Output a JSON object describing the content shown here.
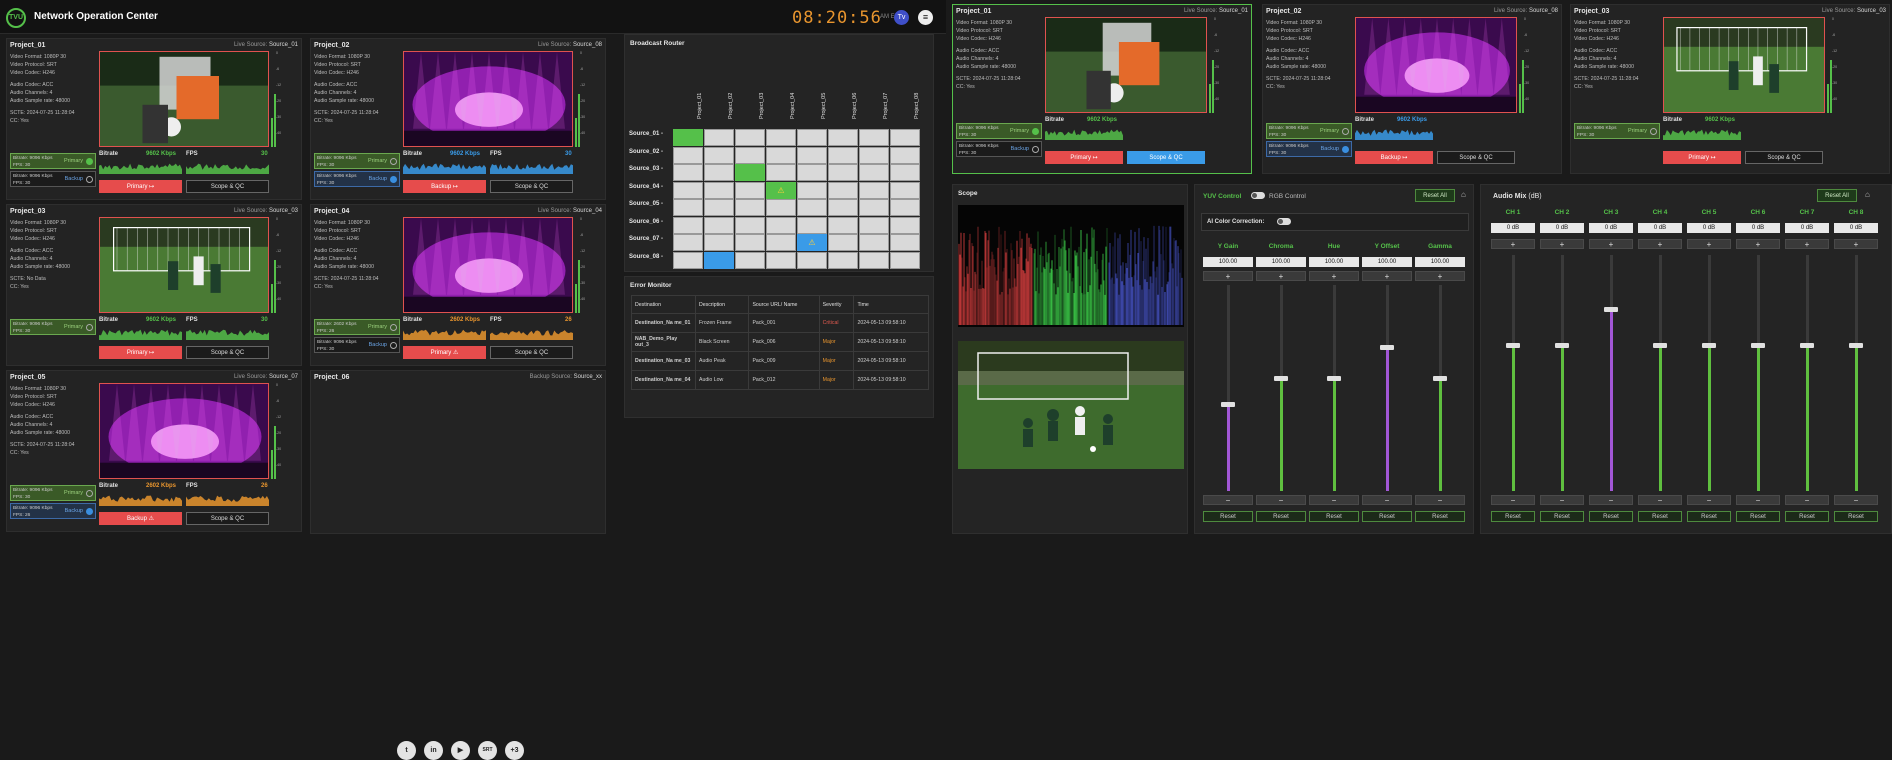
{
  "header": {
    "logo_text": "TVU",
    "title": "Network Operation Center",
    "clock": "08:20:56",
    "timezone": "AM EST",
    "avatar_initial": "Tv",
    "menu_icon": "≡"
  },
  "projects": [
    {
      "name": "Project_01",
      "source_label": "Live Source:",
      "source": "Source_01",
      "info": [
        "Video Format: 1080P 30",
        "Video Protocol: SRT",
        "Video Codec: H246",
        "Audio Codec: ACC",
        "Audio Channels: 4",
        "Audio Sample rate: 48000",
        "SCTE: 2024-07-25 11:28:04",
        "CC: Yes"
      ],
      "primary": {
        "bitrate": "Bitrate: 9096 Kbps",
        "fps": "FPS: 30",
        "label": "Primary"
      },
      "backup": {
        "bitrate": "Bitrate: 9096 Kbps",
        "fps": "FPS: 30",
        "label": "Backup"
      },
      "bitrate_label": "Bitrate",
      "bitrate_value": "9602 Kbps",
      "fps_label": "FPS",
      "fps_value": "30",
      "action": "Primary  ↦",
      "qc": "Scope & QC"
    },
    {
      "name": "Project_02",
      "source_label": "Live Source:",
      "source": "Source_08",
      "info": [
        "Video Format: 1080P 30",
        "Video Protocol: SRT",
        "Video Codec: H246",
        "Audio Codec: ACC",
        "Audio Channels: 4",
        "Audio Sample rate: 48000",
        "SCTE: 2024-07-25 11:28:04",
        "CC: Yes"
      ],
      "primary": {
        "bitrate": "Bitrate: 9096 Kbps",
        "fps": "FPS: 30",
        "label": "Primary"
      },
      "backup": {
        "bitrate": "Bitrate: 9096 Kbps",
        "fps": "FPS: 30",
        "label": "Backup"
      },
      "bitrate_label": "Bitrate",
      "bitrate_value": "9602 Kbps",
      "fps_label": "FPS",
      "fps_value": "30",
      "action": "Backup  ↦",
      "qc": "Scope & QC"
    },
    {
      "name": "Project_03",
      "source_label": "Live Source:",
      "source": "Source_03",
      "info": [
        "Video Format: 1080P 30",
        "Video Protocol: SRT",
        "Video Codec: H246",
        "Audio Codec: ACC",
        "Audio Channels: 4",
        "Audio Sample rate: 48000",
        "SCTE: No Data",
        "CC: Yes"
      ],
      "primary": {
        "bitrate": "Bitrate: 9096 Kbps",
        "fps": "FPS: 30",
        "label": "Primary"
      },
      "backup": {
        "bitrate": "",
        "fps": "",
        "label": ""
      },
      "bitrate_label": "Bitrate",
      "bitrate_value": "9602 Kbps",
      "fps_label": "FPS",
      "fps_value": "30",
      "action": "Primary  ↦",
      "qc": "Scope & QC"
    },
    {
      "name": "Project_04",
      "source_label": "Live Source:",
      "source": "Source_04",
      "info": [
        "Video Format: 1080P 30",
        "Video Protocol: SRT",
        "Video Codec: H246",
        "Audio Codec: ACC",
        "Audio Channels: 4",
        "Audio Sample rate: 48000",
        "SCTE: 2024-07-25 11:28:04",
        "CC: Yes"
      ],
      "primary": {
        "bitrate": "Bitrate: 2602 Kbps",
        "fps": "FPS: 26",
        "label": "Primary"
      },
      "backup": {
        "bitrate": "Bitrate: 9096 Kbps",
        "fps": "FPS: 30",
        "label": "Backup"
      },
      "bitrate_label": "Bitrate",
      "bitrate_value": "2602 Kbps",
      "fps_label": "FPS",
      "fps_value": "26",
      "action": "Primary  ⚠",
      "qc": "Scope & QC"
    },
    {
      "name": "Project_05",
      "source_label": "Live Source:",
      "source": "Source_07",
      "info": [
        "Video Format: 1080P 30",
        "Video Protocol: SRT",
        "Video Codec: H246",
        "Audio Codec: ACC",
        "Audio Channels: 4",
        "Audio Sample rate: 48000",
        "SCTE: 2024-07-25 11:28:04",
        "CC: Yes"
      ],
      "primary": {
        "bitrate": "Bitrate: 9096 Kbps",
        "fps": "FPS: 30",
        "label": "Primary"
      },
      "backup": {
        "bitrate": "Bitrate: 9096 Kbps",
        "fps": "FPS: 26",
        "label": "Backup"
      },
      "bitrate_label": "Bitrate",
      "bitrate_value": "2602 Kbps",
      "fps_label": "FPS",
      "fps_value": "26",
      "action": "Backup  ⚠",
      "qc": "Scope & QC"
    },
    {
      "name": "Project_06",
      "source_label": "Backup Source:",
      "source": "Source_xx"
    }
  ],
  "socials": [
    "t",
    "in",
    "▶",
    "SRT",
    "+3"
  ],
  "router": {
    "title": "Broadcast Router",
    "columns": [
      "Project_01",
      "Project_02",
      "Project_03",
      "Project_04",
      "Project_05",
      "Project_06",
      "Project_07",
      "Project_08"
    ],
    "rows": [
      "Source_01 -",
      "Source_02 -",
      "Source_03 -",
      "Source_04 -",
      "Source_05 -",
      "Source_06 -",
      "Source_07 -",
      "Source_08 -"
    ],
    "warning_icon": "⚠"
  },
  "errors": {
    "title": "Error Monitor",
    "headers": [
      "Destination",
      "Description",
      "Source URL/ Name",
      "Severity",
      "Time"
    ],
    "rows": [
      {
        "dest": "Destination_Na me_01",
        "desc": "Frozen Frame",
        "src": "Pack_001",
        "sev": "Critical",
        "time": "2024-05-13 09:58:10"
      },
      {
        "dest": "NAB_Demo_Play out_3",
        "desc": "Black Screen",
        "src": "Pack_006",
        "sev": "Major",
        "time": "2024-05-13 09:58:10"
      },
      {
        "dest": "Destination_Na me_03",
        "desc": "Audio Peak",
        "src": "Pack_009",
        "sev": "Major",
        "time": "2024-05-13 09:58:10"
      },
      {
        "dest": "Destination_Na me_04",
        "desc": "Audio Low",
        "src": "Pack_012",
        "sev": "Major",
        "time": "2024-05-13 09:58:10"
      }
    ]
  },
  "right_projects": [
    {
      "name": "Project_01",
      "source_label": "Live Source:",
      "source": "Source_01",
      "info": [
        "Video Format: 1080P 30",
        "Video Protocol: SRT",
        "Video Codec: H246",
        "Audio Codec: ACC",
        "Audio Channels: 4",
        "Audio Sample rate: 48000",
        "SCTE: 2024-07-25 11:28:04",
        "CC: Yes"
      ],
      "primary": {
        "bitrate": "Bitrate: 9096 Kbps",
        "fps": "FPS: 30",
        "label": "Primary"
      },
      "backup": {
        "bitrate": "Bitrate: 9096 Kbps",
        "fps": "FPS: 30",
        "label": "Backup"
      },
      "bitrate_label": "Bitrate",
      "bitrate_value": "9602 Kbps",
      "action": "Primary  ↦",
      "qc": "Scope & QC"
    },
    {
      "name": "Project_02",
      "source_label": "Live Source:",
      "source": "Source_08",
      "info": [
        "Video Format: 1080P 30",
        "Video Protocol: SRT",
        "Video Codec: H246",
        "Audio Codec: ACC",
        "Audio Channels: 4",
        "Audio Sample rate: 48000",
        "SCTE: 2024-07-25 11:28:04",
        "CC: Yes"
      ],
      "primary": {
        "bitrate": "Bitrate: 9096 Kbps",
        "fps": "FPS: 30",
        "label": "Primary"
      },
      "backup": {
        "bitrate": "Bitrate: 9096 Kbps",
        "fps": "FPS: 30",
        "label": "Backup"
      },
      "bitrate_label": "Bitrate",
      "bitrate_value": "9602 Kbps",
      "action": "Backup  ↦",
      "qc": "Scope & QC"
    },
    {
      "name": "Project_03",
      "source_label": "Live Source:",
      "source": "Source_03",
      "info": [
        "Video Format: 1080P 30",
        "Video Protocol: SRT",
        "Video Codec: H246",
        "Audio Codec: ACC",
        "Audio Channels: 4",
        "Audio Sample rate: 48000",
        "SCTE: 2024-07-25 11:28:04",
        "CC: Yes"
      ],
      "primary": {
        "bitrate": "Bitrate: 9096 Kbps",
        "fps": "FPS: 30",
        "label": "Primary"
      },
      "backup": {
        "bitrate": "",
        "fps": "",
        "label": ""
      },
      "bitrate_label": "Bitrate",
      "bitrate_value": "9602 Kbps",
      "action": "Primary  ↦",
      "qc": "Scope & QC"
    }
  ],
  "scope": {
    "title": "Scope"
  },
  "color": {
    "tab_yuv": "YUV Control",
    "tab_rgb": "RGB Control",
    "reset_all": "Reset All",
    "ai_label": "AI Color Correction:",
    "sliders": [
      {
        "label": "Y Gain",
        "value": "100.00",
        "level": 0.42,
        "color": "#a257d6"
      },
      {
        "label": "Chroma",
        "value": "100.00",
        "level": 0.55,
        "color": "#5fbf3f"
      },
      {
        "label": "Hue",
        "value": "100.00",
        "level": 0.55,
        "color": "#5fbf3f"
      },
      {
        "label": "Y Offset",
        "value": "100.00",
        "level": 0.7,
        "color": "#a257d6"
      },
      {
        "label": "Gamma",
        "value": "100.00",
        "level": 0.55,
        "color": "#5fbf3f"
      }
    ],
    "plus": "+",
    "minus": "−",
    "reset": "Reset"
  },
  "audio": {
    "title": "Audio Mix",
    "unit": "(dB)",
    "reset_all": "Reset All",
    "channels": [
      {
        "label": "CH 1",
        "value": "0 dB",
        "level": 0.62,
        "color": "#5fbf3f"
      },
      {
        "label": "CH 2",
        "value": "0 dB",
        "level": 0.62,
        "color": "#5fbf3f"
      },
      {
        "label": "CH 3",
        "value": "0 dB",
        "level": 0.77,
        "color": "#a257d6"
      },
      {
        "label": "CH 4",
        "value": "0 dB",
        "level": 0.62,
        "color": "#5fbf3f"
      },
      {
        "label": "CH 5",
        "value": "0 dB",
        "level": 0.62,
        "color": "#5fbf3f"
      },
      {
        "label": "CH 6",
        "value": "0 dB",
        "level": 0.62,
        "color": "#5fbf3f"
      },
      {
        "label": "CH 7",
        "value": "0 dB",
        "level": 0.62,
        "color": "#5fbf3f"
      },
      {
        "label": "CH 8",
        "value": "0 dB",
        "level": 0.62,
        "color": "#5fbf3f"
      }
    ],
    "plus": "+",
    "minus": "−",
    "reset": "Reset"
  },
  "colors": {
    "accent": "#55c04a",
    "alert": "#e64c4c",
    "info": "#3a9be8",
    "warn": "#e8952e",
    "purple": "#a257d6"
  }
}
